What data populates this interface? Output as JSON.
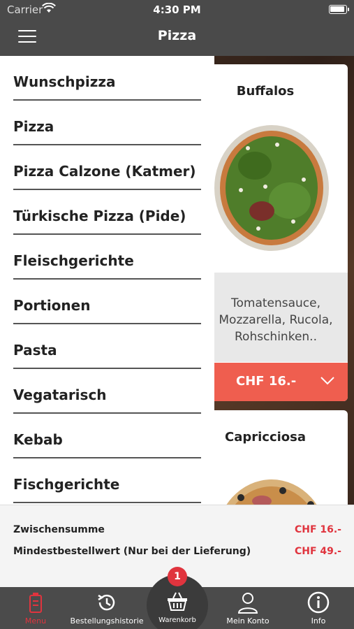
{
  "status_bar": {
    "carrier": "Carrier",
    "time": "4:30 PM"
  },
  "nav": {
    "title": "Pizza"
  },
  "drawer": {
    "items": [
      {
        "label": "Wunschpizza"
      },
      {
        "label": "Pizza"
      },
      {
        "label": "Pizza Calzone (Katmer)"
      },
      {
        "label": "Türkische Pizza (Pide)"
      },
      {
        "label": "Fleischgerichte"
      },
      {
        "label": "Portionen"
      },
      {
        "label": "Pasta"
      },
      {
        "label": "Vegatarisch"
      },
      {
        "label": "Kebab"
      },
      {
        "label": "Fischgerichte"
      }
    ]
  },
  "products": [
    {
      "name": "Buffalos",
      "description": "Tomatensauce, Mozzarella, Rucola, Rohschinken..",
      "price": "CHF 16.-"
    },
    {
      "name": "Capricciosa"
    }
  ],
  "summary": {
    "subtotal_label": "Zwischensumme",
    "subtotal_value": "CHF 16.-",
    "minimum_label": "Mindestbestellwert (Nur bei der Lieferung)",
    "minimum_value": "CHF 49.-"
  },
  "tabbar": {
    "menu": "Menu",
    "history": "Bestellungshistorie",
    "cart": "Warenkorb",
    "cart_badge": "1",
    "account": "Mein Konto",
    "info": "Info"
  },
  "colors": {
    "accent": "#e0343e",
    "price_bar": "#ef5e4f",
    "bar": "#4a4a4a"
  }
}
